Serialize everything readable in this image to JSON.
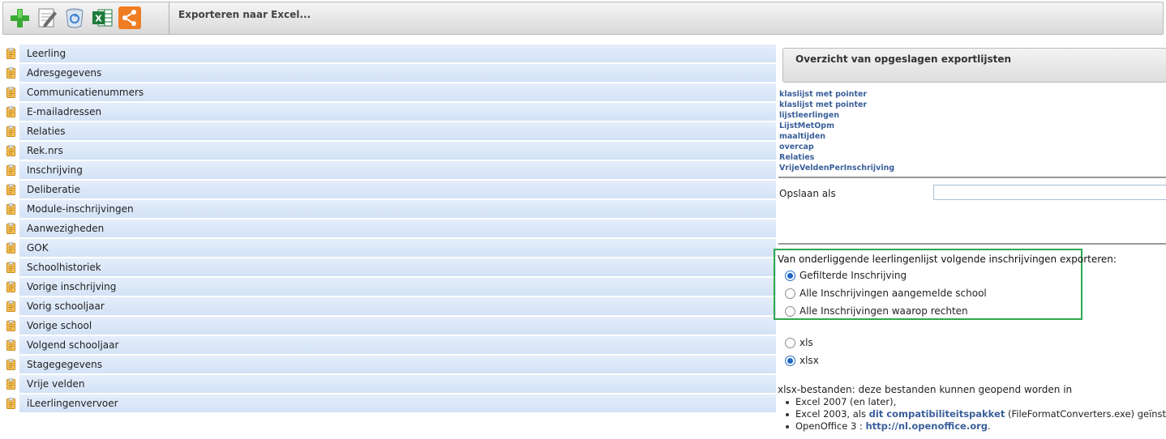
{
  "toolbar": {
    "title": "Exporteren naar Excel...",
    "buttons": [
      {
        "name": "add-icon",
        "color": "#3aa935"
      },
      {
        "name": "edit-icon",
        "color": "#555555"
      },
      {
        "name": "recycle-bin-icon",
        "color": "#3a7fd0"
      },
      {
        "name": "excel-icon",
        "color": "#1e7b3a"
      },
      {
        "name": "share-icon",
        "color": "#f07d22"
      }
    ]
  },
  "categories": [
    "Leerling",
    "Adresgegevens",
    "Communicatienummers",
    "E-mailadressen",
    "Relaties",
    "Rek.nrs",
    "Inschrijving",
    "Deliberatie",
    "Module-inschrijvingen",
    "Aanwezigheden",
    "GOK",
    "Schoolhistoriek",
    "Vorige inschrijving",
    "Vorig schooljaar",
    "Vorige school",
    "Volgend schooljaar",
    "Stagegegevens",
    "Vrije velden",
    "iLeerlingenvervoer"
  ],
  "panel": {
    "title": "Overzicht van opgeslagen exportlijsten",
    "saved_lists": [
      "klaslijst met pointer",
      "klaslijst met pointer",
      "lijstleerlingen",
      "LijstMetOpm",
      "maaltijden",
      "overcap",
      "Relaties",
      "VrijeVeldenPerInschrijving"
    ],
    "save_as_label": "Opslaan als",
    "save_as_value": ""
  },
  "enrollment": {
    "title": "Van onderliggende leerlingenlijst volgende inschrijvingen exporteren:",
    "options": [
      {
        "label": "Gefilterde Inschrijving",
        "selected": true
      },
      {
        "label": "Alle Inschrijvingen aangemelde school",
        "selected": false
      },
      {
        "label": "Alle Inschrijvingen waarop rechten",
        "selected": false
      }
    ]
  },
  "format": {
    "options": [
      {
        "label": "xls",
        "selected": false
      },
      {
        "label": "xlsx",
        "selected": true
      }
    ]
  },
  "info": {
    "intro": "xlsx-bestanden: deze bestanden kunnen geopend worden in",
    "line1": "Excel 2007 (en later),",
    "line2_pre": "Excel 2003, als ",
    "line2_link": "dit compatibiliteitspakket",
    "line2_post": " (FileFormatConverters.exe) geïnstalleerd is,",
    "line3_pre": "OpenOffice 3 : ",
    "line3_link": "http://nl.openoffice.org",
    "line3_post": "."
  },
  "colors": {
    "accent_green": "#2fa84f",
    "link_blue": "#3a5f9a",
    "row_blue": "#dbe7f8"
  }
}
